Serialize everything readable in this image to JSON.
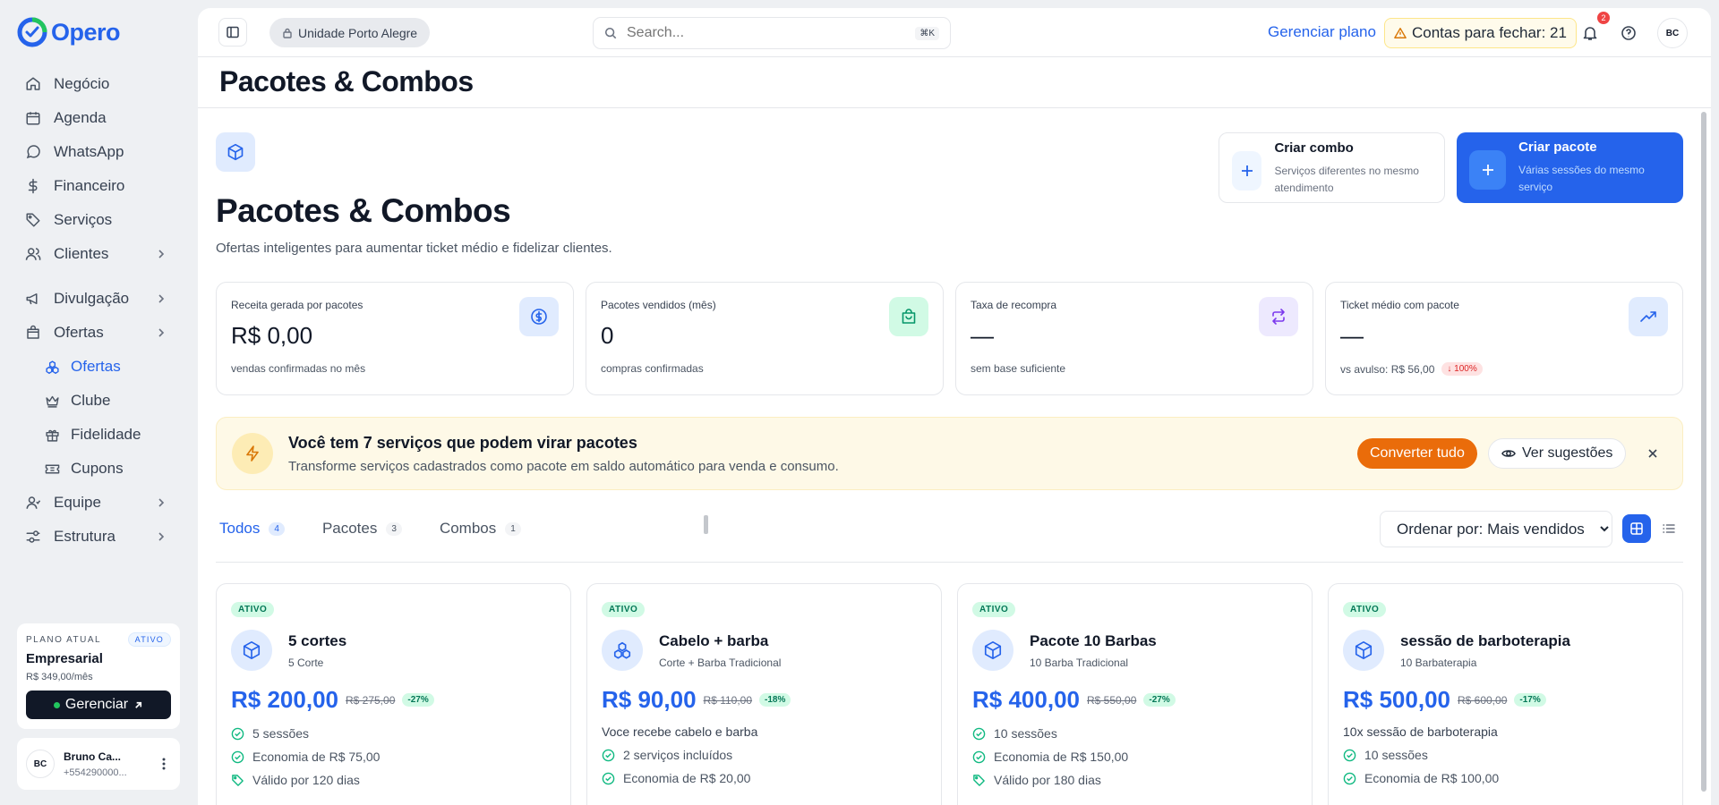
{
  "brand": {
    "name": "Opero"
  },
  "sidebar": {
    "items": [
      {
        "label": "Negócio",
        "icon": "home-icon"
      },
      {
        "label": "Agenda",
        "icon": "calendar-icon"
      },
      {
        "label": "WhatsApp",
        "icon": "chat-bubble-icon"
      },
      {
        "label": "Financeiro",
        "icon": "dollar-icon"
      },
      {
        "label": "Serviços",
        "icon": "tag-icon"
      },
      {
        "label": "Clientes",
        "icon": "users-icon"
      },
      {
        "label": "Divulgação",
        "icon": "megaphone-icon"
      },
      {
        "label": "Ofertas",
        "icon": "shopping-bag-icon"
      },
      {
        "label": "Equipe",
        "icon": "user-team-icon"
      },
      {
        "label": "Estrutura",
        "icon": "sliders-icon"
      }
    ],
    "subitems": [
      {
        "label": "Ofertas",
        "icon": "boxes-icon"
      },
      {
        "label": "Clube",
        "icon": "crown-icon"
      },
      {
        "label": "Fidelidade",
        "icon": "gift-icon"
      },
      {
        "label": "Cupons",
        "icon": "ticket-icon"
      }
    ],
    "plan": {
      "label": "PLANO ATUAL",
      "badge": "ATIVO",
      "name": "Empresarial",
      "price": "R$ 349,00/mês",
      "manage": "Gerenciar"
    },
    "user": {
      "initials": "BC",
      "name": "Bruno Ca...",
      "phone": "+554290000..."
    }
  },
  "topbar": {
    "unit": "Unidade Porto Alegre",
    "search_placeholder": "Search...",
    "shortcut": "⌘K",
    "manage_plan": "Gerenciar plano",
    "accounts_alert": "Contas para fechar: 21",
    "notifications": "2",
    "avatar": "BC"
  },
  "page": {
    "header_title": "Pacotes & Combos",
    "title": "Pacotes & Combos",
    "subtitle": "Ofertas inteligentes para aumentar ticket médio e fidelizar clientes."
  },
  "actions": {
    "combo": {
      "label": "Criar combo",
      "desc": "Serviços diferentes no mesmo atendimento"
    },
    "package": {
      "label": "Criar pacote",
      "desc": "Várias sessões do mesmo serviço"
    }
  },
  "stats": [
    {
      "label": "Receita gerada por pacotes",
      "value": "R$ 0,00",
      "note": "vendas confirmadas no mês",
      "icon": "dollar-circle-icon",
      "color": "#2563eb",
      "bg": "#e0ebfe"
    },
    {
      "label": "Pacotes vendidos (mês)",
      "value": "0",
      "note": "compras confirmadas",
      "icon": "shopping-bag-icon",
      "color": "#059669",
      "bg": "#d1fae5"
    },
    {
      "label": "Taxa de recompra",
      "value": "—",
      "note": "sem base suficiente",
      "icon": "repeat-icon",
      "color": "#7c3aed",
      "bg": "#ede9fe"
    },
    {
      "label": "Ticket médio com pacote",
      "value": "—",
      "note": "vs avulso: R$ 56,00",
      "delta": "↓ 100%",
      "icon": "trending-up-icon",
      "color": "#2563eb",
      "bg": "#e0ebfe"
    }
  ],
  "banner": {
    "title": "Você tem 7 serviços que podem virar pacotes",
    "subtitle": "Transforme serviços cadastrados como pacote em saldo automático para venda e consumo.",
    "convert": "Converter tudo",
    "suggest": "Ver sugestões"
  },
  "tabs": [
    {
      "label": "Todos",
      "count": "4",
      "active": true
    },
    {
      "label": "Pacotes",
      "count": "3"
    },
    {
      "label": "Combos",
      "count": "1"
    }
  ],
  "sort": {
    "selected": "Ordenar por: Mais vendidos"
  },
  "cards": [
    {
      "status": "ATIVO",
      "title": "5 cortes",
      "subtitle": "5 Corte",
      "price": "R$ 200,00",
      "old": "R$ 275,00",
      "discount": "-27%",
      "desc": "",
      "features": [
        "5 sessões",
        "Economia de R$ 75,00",
        "Válido por 120 dias"
      ]
    },
    {
      "status": "ATIVO",
      "title": "Cabelo + barba",
      "subtitle": "Corte + Barba Tradicional",
      "price": "R$ 90,00",
      "old": "R$ 110,00",
      "discount": "-18%",
      "desc": "Voce recebe cabelo e barba",
      "features": [
        "2 serviços incluídos",
        "Economia de R$ 20,00"
      ]
    },
    {
      "status": "ATIVO",
      "title": "Pacote 10 Barbas",
      "subtitle": "10 Barba Tradicional",
      "price": "R$ 400,00",
      "old": "R$ 550,00",
      "discount": "-27%",
      "desc": "",
      "features": [
        "10 sessões",
        "Economia de R$ 150,00",
        "Válido por 180 dias"
      ]
    },
    {
      "status": "ATIVO",
      "title": "sessão de barboterapia",
      "subtitle": "10 Barbaterapia",
      "price": "R$ 500,00",
      "old": "R$ 600,00",
      "discount": "-17%",
      "desc": "10x sessão de barboterapia",
      "features": [
        "10 sessões",
        "Economia de R$ 100,00"
      ]
    }
  ]
}
